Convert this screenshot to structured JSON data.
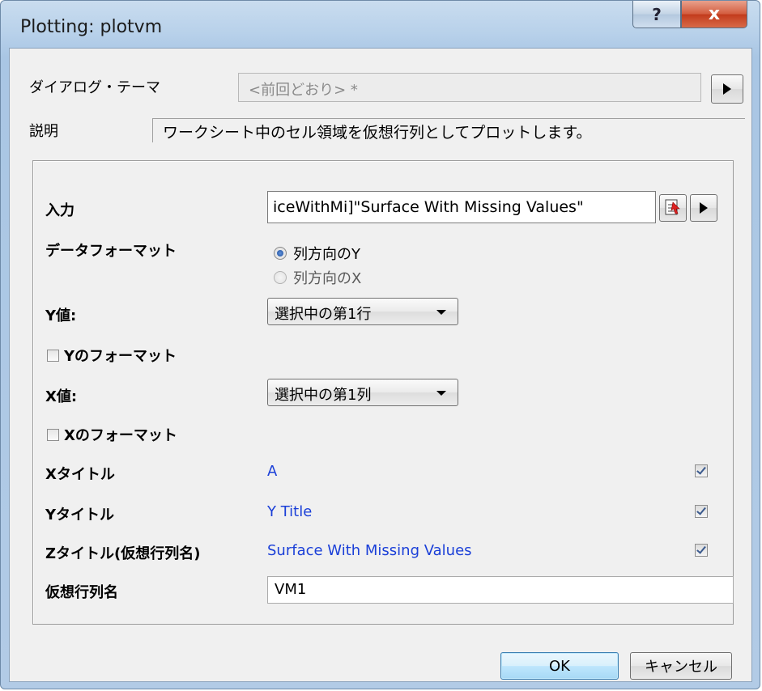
{
  "window": {
    "title": "Plotting: plotvm",
    "help_label": "?",
    "close_label": "x"
  },
  "theme": {
    "label": "ダイアログ・テーマ",
    "value": "<前回どおり> *"
  },
  "description": {
    "label": "説明",
    "text": "ワークシート中のセル領域を仮想行列としてプロットします。"
  },
  "input": {
    "label": "入力",
    "value": "iceWithMi]\"Surface With Missing Values\""
  },
  "data_format": {
    "label": "データフォーマット",
    "options": [
      {
        "label": "列方向のY",
        "selected": true
      },
      {
        "label": "列方向のX",
        "selected": false
      }
    ]
  },
  "y_values": {
    "label": "Y値:",
    "selected": "選択中の第1行"
  },
  "y_format": {
    "label": "Yのフォーマット",
    "checked": false
  },
  "x_values": {
    "label": "X値:",
    "selected": "選択中の第1列"
  },
  "x_format": {
    "label": "Xのフォーマット",
    "checked": false
  },
  "x_title": {
    "label": "Xタイトル",
    "value": "A",
    "checked": true
  },
  "y_title": {
    "label": "Yタイトル",
    "value": "Y Title",
    "checked": true
  },
  "z_title": {
    "label": "Zタイトル(仮想行列名)",
    "value": "Surface With Missing Values",
    "checked": true
  },
  "vm_name": {
    "label": "仮想行列名",
    "value": "VM1"
  },
  "buttons": {
    "ok": "OK",
    "cancel": "キャンセル"
  }
}
